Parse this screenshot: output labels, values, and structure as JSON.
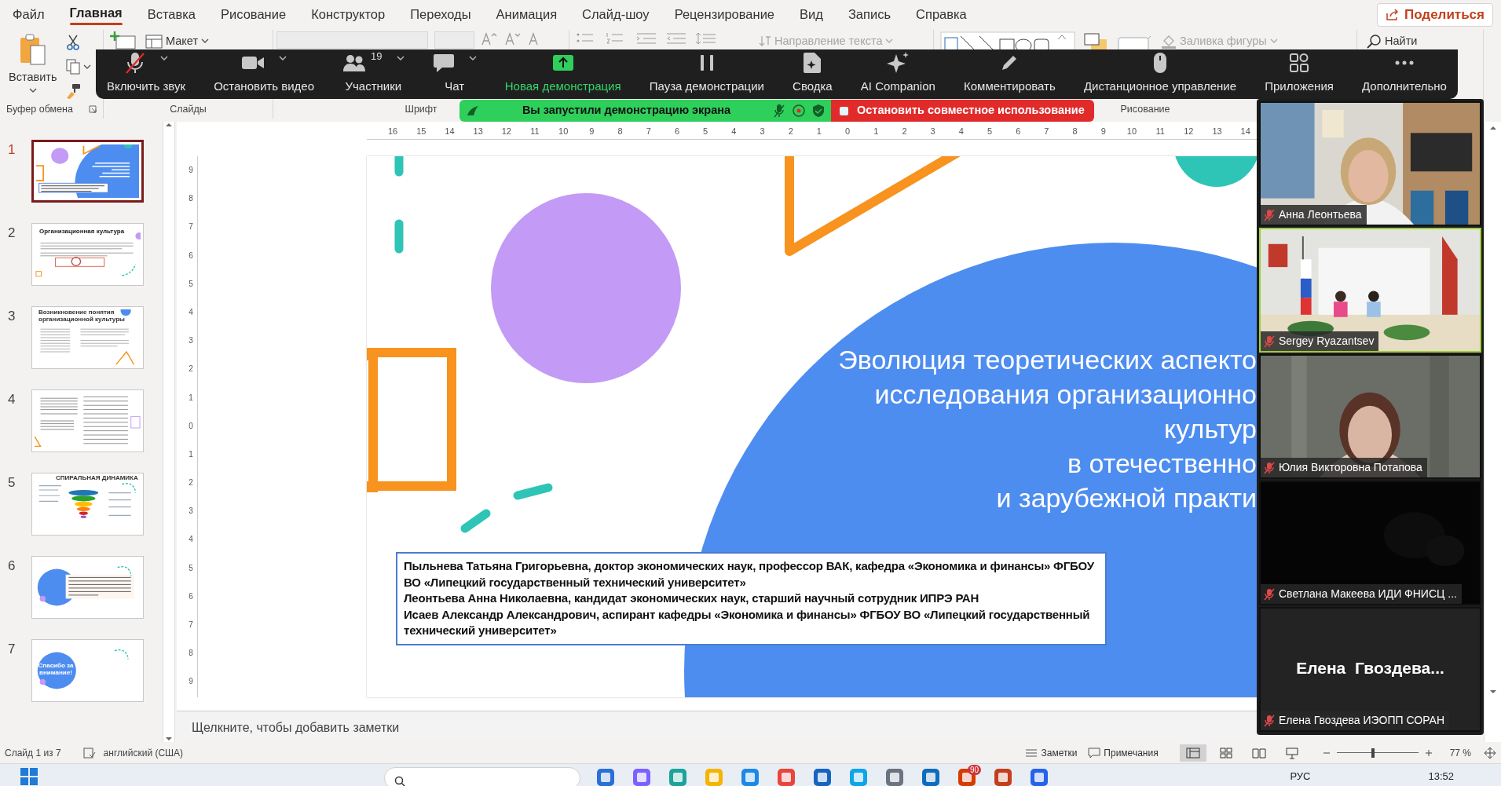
{
  "menu_tabs": [
    {
      "label": "Файл",
      "selected": false
    },
    {
      "label": "Главная",
      "selected": true
    },
    {
      "label": "Вставка",
      "selected": false
    },
    {
      "label": "Рисование",
      "selected": false
    },
    {
      "label": "Конструктор",
      "selected": false
    },
    {
      "label": "Переходы",
      "selected": false
    },
    {
      "label": "Анимация",
      "selected": false
    },
    {
      "label": "Слайд-шоу",
      "selected": false
    },
    {
      "label": "Рецензирование",
      "selected": false
    },
    {
      "label": "Вид",
      "selected": false
    },
    {
      "label": "Запись",
      "selected": false
    },
    {
      "label": "Справка",
      "selected": false
    }
  ],
  "share_button": {
    "label": "Поделиться"
  },
  "ribbon": {
    "groups": [
      {
        "kind": "clipboard",
        "label": "Буфер обмена",
        "paste": "Вставить"
      },
      {
        "kind": "slides",
        "label": "Слайды",
        "layout": "Макет"
      },
      {
        "kind": "font",
        "label": "Шрифт"
      },
      {
        "kind": "paragraph",
        "text_direction": {
          "label": "Направление текста",
          "disabled": true
        }
      },
      {
        "kind": "drawing",
        "label": "Рисование",
        "shape_fill": {
          "label": "Заливка фигуры",
          "disabled": true
        }
      },
      {
        "kind": "editing",
        "find": "Найти"
      }
    ]
  },
  "meeting_toolbar": {
    "buttons": [
      {
        "kind": "audio",
        "label": "Включить звук",
        "caret": true
      },
      {
        "kind": "video",
        "label": "Остановить видео",
        "caret": true
      },
      {
        "kind": "participants",
        "label": "Участники",
        "count": "19",
        "caret": true
      },
      {
        "kind": "chat",
        "label": "Чат",
        "caret": true
      },
      {
        "kind": "share",
        "label": "Новая демонстрация",
        "caret": false
      },
      {
        "kind": "pause",
        "label": "Пауза демонстрации",
        "caret": false
      },
      {
        "kind": "summary",
        "label": "Сводка",
        "caret": false
      },
      {
        "kind": "ai",
        "label": "AI Companion",
        "caret": false
      },
      {
        "kind": "annotate",
        "label": "Комментировать",
        "caret": false
      },
      {
        "kind": "remote",
        "label": "Дистанционное управление",
        "caret": false
      },
      {
        "kind": "apps",
        "label": "Приложения",
        "caret": false
      },
      {
        "kind": "more",
        "label": "Дополнительно",
        "caret": false
      }
    ]
  },
  "share_banner": {
    "status": "Вы запустили демонстрацию экрана",
    "stop": "Остановить совместное использование"
  },
  "thumbnails": [
    {
      "number": "1",
      "kind": "title",
      "selected": true
    },
    {
      "number": "2",
      "kind": "text",
      "title": "Организационная культура",
      "selected": false
    },
    {
      "number": "3",
      "kind": "columns",
      "title": "Возникновение понятия организационной культуры",
      "selected": false
    },
    {
      "number": "4",
      "kind": "list",
      "selected": false
    },
    {
      "number": "5",
      "kind": "spiral",
      "title": "СПИРАЛЬНАЯ ДИНАМИКА",
      "selected": false
    },
    {
      "number": "6",
      "kind": "quote",
      "selected": false
    },
    {
      "number": "7",
      "kind": "thanks",
      "title": "Спасибо за внимание!",
      "selected": false
    }
  ],
  "horizontal_ruler": [
    "16",
    "15",
    "14",
    "13",
    "12",
    "11",
    "10",
    "9",
    "8",
    "7",
    "6",
    "5",
    "4",
    "3",
    "2",
    "1",
    "0",
    "1",
    "2",
    "3",
    "4",
    "5",
    "6",
    "7",
    "8",
    "9",
    "10",
    "11",
    "12",
    "13",
    "14"
  ],
  "vertical_ruler": [
    "9",
    "8",
    "7",
    "6",
    "5",
    "4",
    "3",
    "2",
    "1",
    "0",
    "1",
    "2",
    "3",
    "4",
    "5",
    "6",
    "7",
    "8",
    "9"
  ],
  "slide": {
    "title_lines": [
      "Эволюция теоретических аспекто",
      "исследования организационно",
      "культур",
      "в отечественно",
      "и зарубежной практи"
    ],
    "authors": [
      "Пыльнева Татьяна Григорьевна, доктор экономических наук, профессор ВАК, кафедра «Экономика и финансы» ФГБОУ ВО «Липецкий государственный технический университет»",
      "Леонтьева Анна Николаевна, кандидат экономических наук, старший научный сотрудник ИПРЭ РАН",
      "Исаев Александр Александрович, аспирант кафедры «Экономика и финансы» ФГБОУ ВО «Липецкий государственный технический университет»"
    ]
  },
  "notes_placeholder": "Щелкните, чтобы добавить заметки",
  "video_tiles": [
    {
      "kind": "office",
      "name": "Анна Леонтьева",
      "speaking": false
    },
    {
      "kind": "conference",
      "name": "Sergey Ryazantsev",
      "speaking": true
    },
    {
      "kind": "home",
      "name": "Юлия Викторовна Потапова",
      "speaking": false
    },
    {
      "kind": "dark",
      "name": "Светлана Макеева ИДИ ФНИСЦ ...",
      "speaking": false
    },
    {
      "kind": "avatar",
      "display": "Елена  Гвоздева...",
      "name": "Елена Гвоздева ИЭОПП СОРАН",
      "speaking": false
    }
  ],
  "status_bar": {
    "slide": "Слайд 1 из 7",
    "language": "английский (США)",
    "notes": "Заметки",
    "comments": "Примечания",
    "views": [
      {
        "kind": "normal",
        "selected": true
      },
      {
        "kind": "sorter",
        "selected": false
      },
      {
        "kind": "reading",
        "selected": false
      },
      {
        "kind": "slideshow",
        "selected": false
      }
    ],
    "zoom": {
      "label": "77 %",
      "level": 0.45
    }
  },
  "taskbar": {
    "badge": "90",
    "language": "РУС",
    "time": "13:52"
  }
}
